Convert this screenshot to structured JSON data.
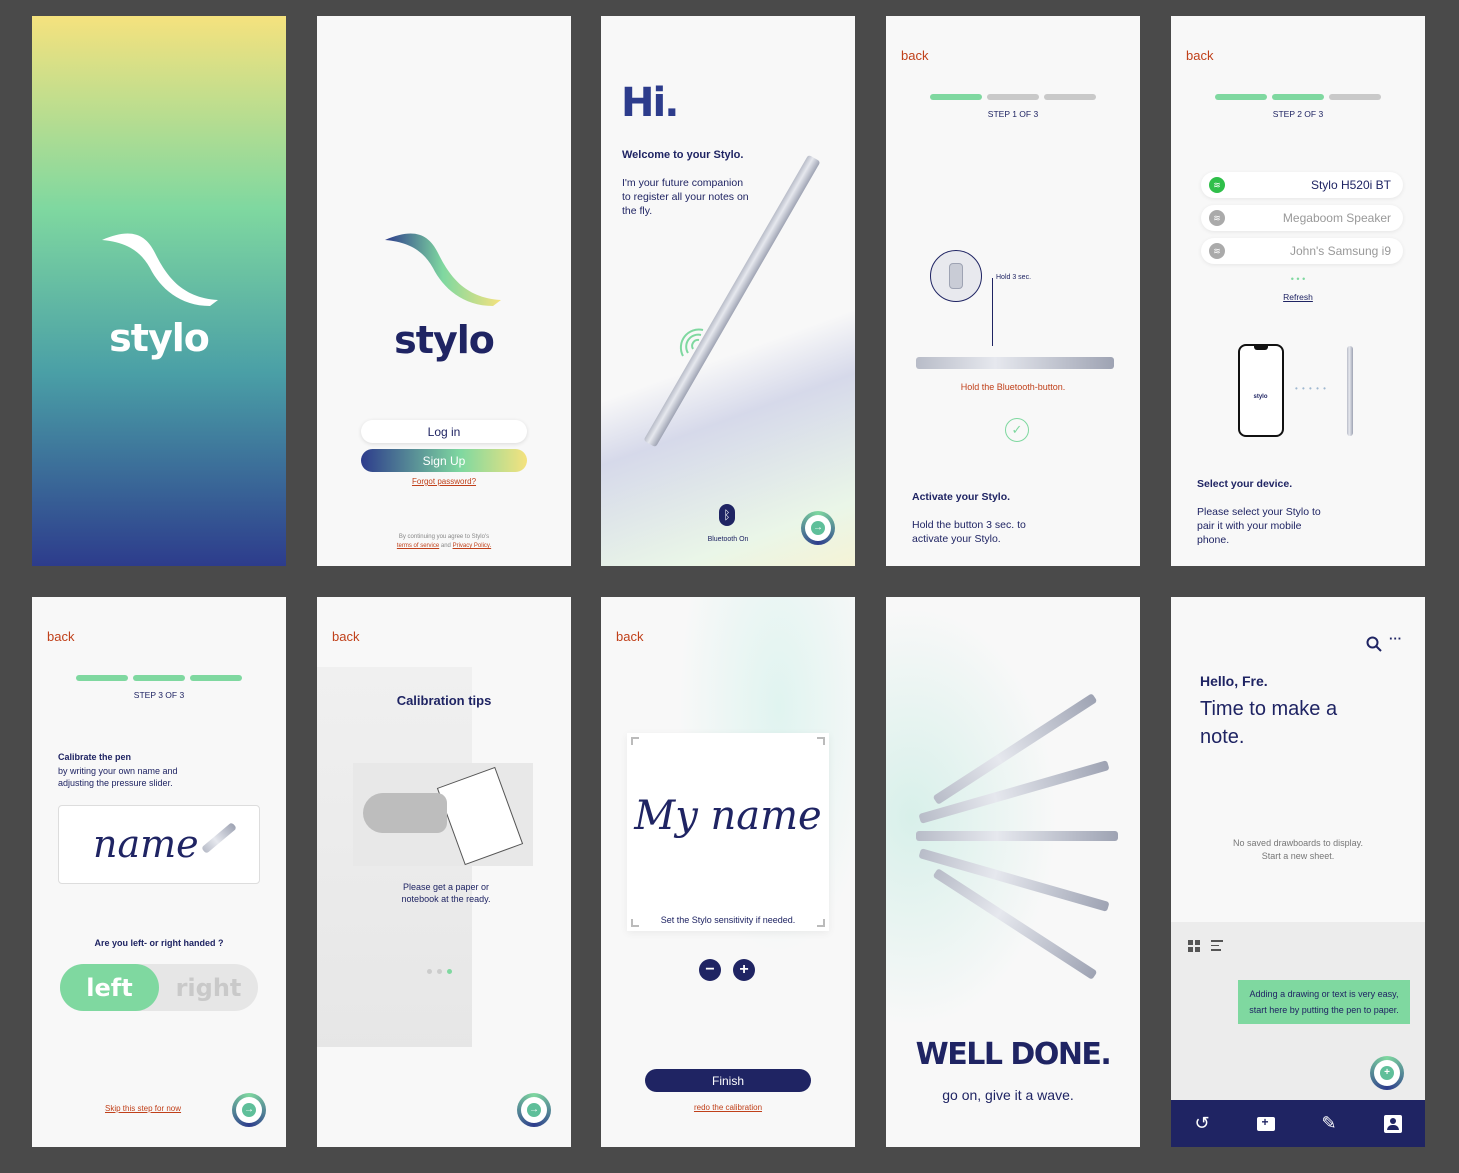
{
  "colors": {
    "navy": "#1f2463",
    "green": "#7fd8a0",
    "orange": "#c0401a",
    "bg": "#f8f8f8",
    "dark_bg": "#4a4a4a"
  },
  "splash": {
    "logo": "stylo"
  },
  "login": {
    "logo": "stylo",
    "login_label": "Log in",
    "signup_label": "Sign Up",
    "forgot_label": "Forgot password?",
    "terms_line1": "By continuing you agree to Stylo's",
    "terms_link": "terms of service",
    "terms_and": "and",
    "privacy_link": "Privacy Policy."
  },
  "welcome": {
    "hi": "Hi.",
    "heading": "Welcome to your Stylo.",
    "body": "I'm your future companion to register all your notes on the fly.",
    "bluetooth_label": "Bluetooth On",
    "bluetooth_icon": "bluetooth-icon"
  },
  "step1": {
    "back": "back",
    "step_label": "STEP 1 OF 3",
    "hold_label": "Hold 3 sec.",
    "pen_label": "Hold the Bluetooth-button.",
    "heading": "Activate your Stylo.",
    "body": "Hold the button 3 sec. to activate your Stylo."
  },
  "step2": {
    "back": "back",
    "step_label": "STEP 2 OF 3",
    "devices": [
      {
        "name": "Stylo H520i BT",
        "active": true
      },
      {
        "name": "Megaboom Speaker",
        "active": false
      },
      {
        "name": "John's Samsung i9",
        "active": false
      }
    ],
    "dots": "• • •",
    "refresh": "Refresh",
    "phone_logo": "stylo",
    "heading": "Select your device.",
    "body": "Please select your Stylo to pair it with your mobile phone."
  },
  "step3": {
    "back": "back",
    "step_label": "STEP 3 OF 3",
    "heading": "Calibrate the pen",
    "body": "by writing your own name and adjusting the pressure slider.",
    "sample": "name",
    "question": "Are you left- or right handed ?",
    "left": "left",
    "right": "right",
    "skip": "Skip this step for now"
  },
  "tips": {
    "back": "back",
    "title": "Calibration tips",
    "body": "Please get a paper or notebook at the ready."
  },
  "calibrate": {
    "back": "back",
    "sample": "My name",
    "hint": "Set the Stylo sensitivity if needed.",
    "minus": "−",
    "plus": "+",
    "finish": "Finish",
    "redo": "redo the calibration"
  },
  "done": {
    "title": "WELL DONE.",
    "subtitle": "go on, give it a wave."
  },
  "home": {
    "greeting": "Hello, Fre.",
    "headline": "Time to make a note.",
    "empty_line1": "No saved drawboards to display.",
    "empty_line2": "Start a new sheet.",
    "tooltip": "Adding a drawing or text is very easy, start here by putting the pen to paper.",
    "nav": [
      "history-icon",
      "folder-add-icon",
      "pen-icon",
      "profile-icon"
    ]
  }
}
